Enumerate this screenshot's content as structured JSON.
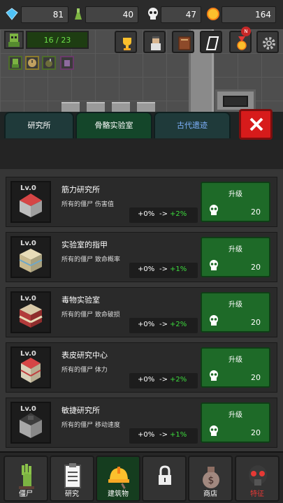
{
  "resources": [
    {
      "icon": "diamond-icon",
      "value": "81"
    },
    {
      "icon": "potion-icon",
      "value": "40"
    },
    {
      "icon": "skull-icon",
      "value": "47"
    },
    {
      "icon": "coin-icon",
      "value": "164"
    }
  ],
  "player": {
    "hp": "16 / 23"
  },
  "notification_badge": "N",
  "tabs": [
    {
      "label": "研究所",
      "active": false
    },
    {
      "label": "骨骼实验室",
      "active": true
    },
    {
      "label": "古代遗迹",
      "active": false
    }
  ],
  "research": [
    {
      "level": "Lv.0",
      "name": "筋力研究所",
      "desc": "所有的僵尸 伤害值",
      "base": "+0%",
      "arrow": "->",
      "bonus": "+2%",
      "button": "升级",
      "cost": "20"
    },
    {
      "level": "Lv.0",
      "name": "实验室的指甲",
      "desc": "所有的僵尸 致命概率",
      "base": "+0%",
      "arrow": "->",
      "bonus": "+1%",
      "button": "升级",
      "cost": "20"
    },
    {
      "level": "Lv.0",
      "name": "毒物实验室",
      "desc": "所有的僵尸 致命破损",
      "base": "+0%",
      "arrow": "->",
      "bonus": "+2%",
      "button": "升级",
      "cost": "20"
    },
    {
      "level": "Lv.0",
      "name": "表皮研究中心",
      "desc": "所有的僵尸 体力",
      "base": "+0%",
      "arrow": "->",
      "bonus": "+2%",
      "button": "升级",
      "cost": "20"
    },
    {
      "level": "Lv.0",
      "name": "敏捷研究所",
      "desc": "所有的僵尸 移动速度",
      "base": "+0%",
      "arrow": "->",
      "bonus": "+1%",
      "button": "升级",
      "cost": "20"
    }
  ],
  "nav": [
    {
      "label": "僵尸",
      "icon": "zombie-hand-icon"
    },
    {
      "label": "研究",
      "icon": "clipboard-icon"
    },
    {
      "label": "建筑物",
      "icon": "hardhat-icon",
      "active": true
    },
    {
      "label": "",
      "icon": "lock-icon"
    },
    {
      "label": "商店",
      "icon": "money-bag-icon"
    },
    {
      "label": "特征",
      "icon": "gasmask-icon"
    }
  ],
  "colors": {
    "accent_green": "#1e6a28",
    "bonus_green": "#3ddc3d",
    "close_red": "#d71b1b"
  }
}
